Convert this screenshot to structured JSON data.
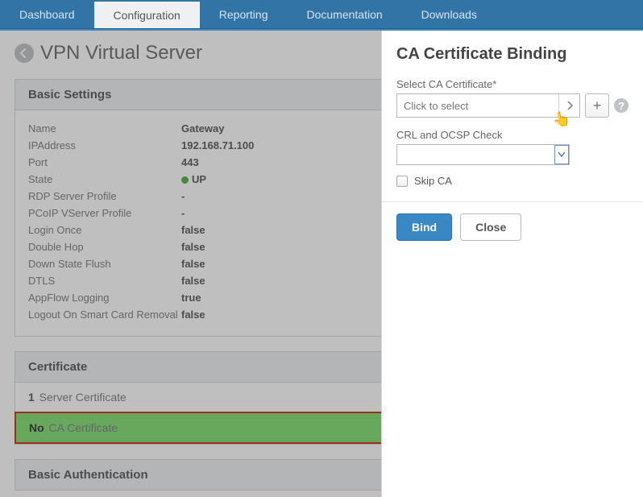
{
  "nav": {
    "tabs": [
      {
        "label": "Dashboard",
        "active": false
      },
      {
        "label": "Configuration",
        "active": true
      },
      {
        "label": "Reporting",
        "active": false
      },
      {
        "label": "Documentation",
        "active": false
      },
      {
        "label": "Downloads",
        "active": false
      }
    ]
  },
  "page": {
    "title": "VPN Virtual Server",
    "basic_settings_header": "Basic Settings",
    "certificate_header": "Certificate",
    "basic_auth_header": "Basic Authentication",
    "settings": {
      "name_k": "Name",
      "name_v": "Gateway",
      "ip_k": "IPAddress",
      "ip_v": "192.168.71.100",
      "port_k": "Port",
      "port_v": "443",
      "state_k": "State",
      "state_v": "UP",
      "rdp_k": "RDP Server Profile",
      "rdp_v": "-",
      "pcoip_k": "PCoIP VServer Profile",
      "pcoip_v": "-",
      "loginonce_k": "Login Once",
      "loginonce_v": "false",
      "doublehop_k": "Double Hop",
      "doublehop_v": "false",
      "downstate_k": "Down State Flush",
      "downstate_v": "false",
      "dtls_k": "DTLS",
      "dtls_v": "false",
      "appflow_k": "AppFlow Logging",
      "appflow_v": "true",
      "logoutsc_k": "Logout On Smart Card Removal",
      "logoutsc_v": "false"
    },
    "server_cert_count": "1",
    "server_cert_label": " Server Certificate",
    "no_ca_label1": "No",
    "no_ca_label2": " CA Certificate"
  },
  "flyout": {
    "title": "CA Certificate Binding",
    "select_label": "Select CA Certificate*",
    "select_placeholder": "Click to select",
    "crl_label": "CRL and OCSP Check",
    "skip_ca": "Skip CA",
    "bind": "Bind",
    "close": "Close"
  }
}
